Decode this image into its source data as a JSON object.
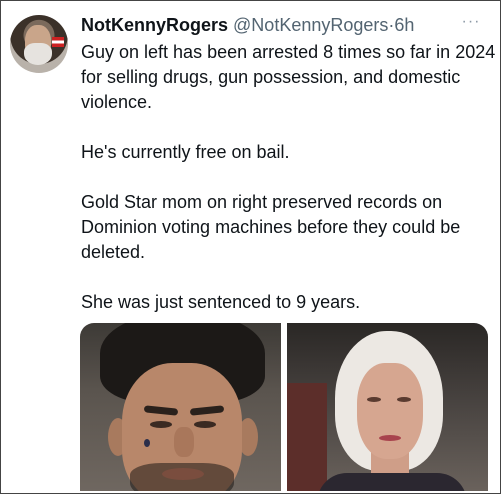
{
  "tweet": {
    "author": {
      "display_name": "NotKennyRogers",
      "handle": "@NotKennyRogers",
      "separator": "·",
      "timestamp": "6h"
    },
    "more_label": "···",
    "paragraphs": [
      "Guy on left has been arrested 8 times so far in 2024 for selling drugs, gun possession, and domestic violence.",
      "He's currently free on bail.",
      "Gold Star mom on right preserved records on Dominion voting machines before they could be deleted.",
      "She was just sentenced to 9 years."
    ],
    "media": {
      "count": 2,
      "left": "mugshot-photo",
      "right": "portrait-photo"
    }
  },
  "colors": {
    "text_primary": "#0f1419",
    "text_secondary": "#536471",
    "frame_border": "#444444"
  },
  "icons": {
    "more": "more-horizontal-icon"
  }
}
